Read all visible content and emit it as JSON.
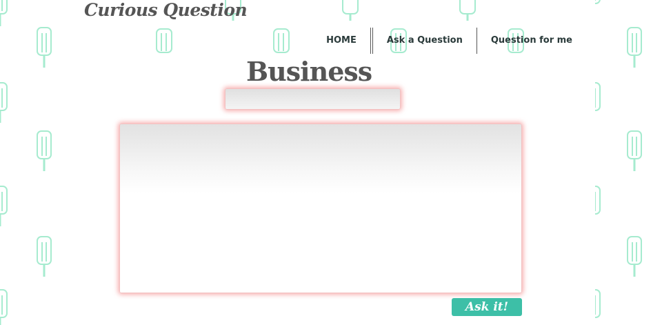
{
  "site": {
    "logo": "Curious Question"
  },
  "nav": {
    "items": [
      "HOME",
      "Ask a Question",
      "Question for me"
    ]
  },
  "page": {
    "title": "Business"
  },
  "form": {
    "title_input": {
      "value": "",
      "placeholder": ""
    },
    "question_textarea": {
      "value": "",
      "placeholder": ""
    },
    "submit_label": "Ask it!"
  },
  "colors": {
    "popsicle": "#a6ebcf",
    "button": "#3dbfa7",
    "field_glow": "#f06e6e",
    "heading": "#555555"
  },
  "icons": {
    "background_pattern": "popsicle-icon"
  }
}
